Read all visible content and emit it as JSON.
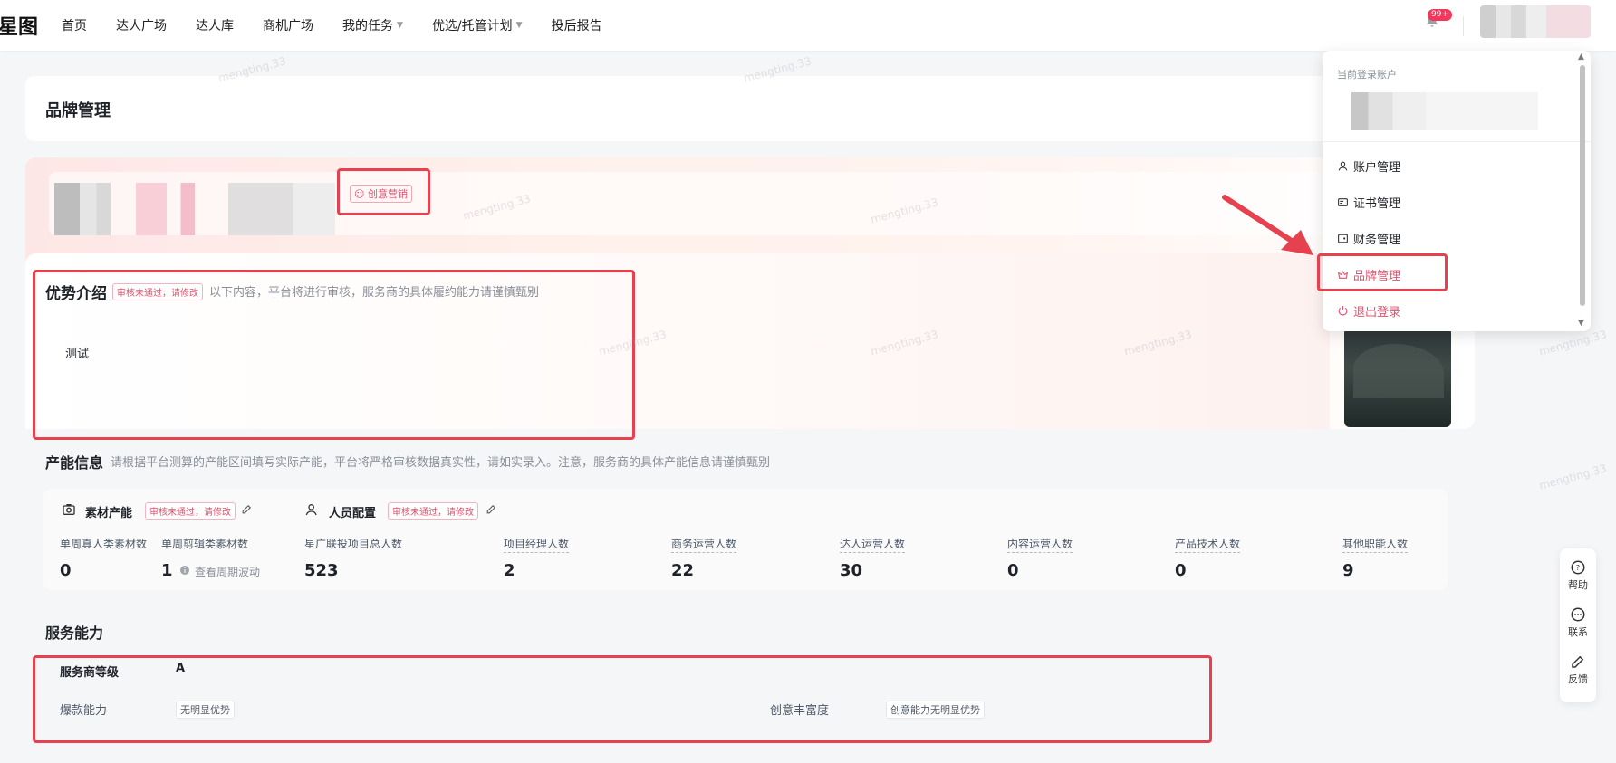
{
  "nav": {
    "logo": "星图",
    "items": [
      "首页",
      "达人广场",
      "达人库",
      "商机广场",
      "我的任务",
      "优选/托管计划",
      "投后报告"
    ],
    "badge": "99+"
  },
  "page": {
    "title": "品牌管理"
  },
  "brand": {
    "tag": "创意营销"
  },
  "advantage": {
    "title": "优势介绍",
    "status": "审核未通过，请修改",
    "hint": "以下内容，平台将进行审核，服务商的具体履约能力请谨慎甄别",
    "content": "测试"
  },
  "capacity": {
    "title": "产能信息",
    "hint": "请根据平台测算的产能区间填写实际产能，平台将严格审核数据真实性，请如实录入。注意，服务商的具体产能信息请谨慎甄别",
    "material": {
      "title": "素材产能",
      "status": "审核未通过，请修改",
      "labels": [
        "单周真人类素材数",
        "单周剪辑类素材数"
      ],
      "values": [
        "0",
        "1"
      ],
      "fluct": "查看周期波动"
    },
    "staff": {
      "title": "人员配置",
      "status": "审核未通过，请修改",
      "labels": [
        "星广联投项目总人数",
        "项目经理人数",
        "商务运营人数",
        "达人运营人数",
        "内容运营人数",
        "产品技术人数",
        "其他职能人数"
      ],
      "values": [
        "523",
        "2",
        "22",
        "30",
        "0",
        "0",
        "9"
      ]
    }
  },
  "service": {
    "title": "服务能力",
    "level_label": "服务商等级",
    "level_value": "A",
    "hit_label": "爆款能力",
    "hit_value": "无明显优势",
    "creative_label": "创意丰富度",
    "creative_value": "创意能力无明显优势"
  },
  "dropdown": {
    "label": "当前登录账户",
    "items": [
      "账户管理",
      "证书管理",
      "财务管理",
      "品牌管理",
      "退出登录"
    ]
  },
  "side_tools": [
    "帮助",
    "联系",
    "反馈"
  ],
  "watermark": "mengting.33",
  "colors": {
    "accent": "#e0526e",
    "annotation": "#e5414f"
  }
}
